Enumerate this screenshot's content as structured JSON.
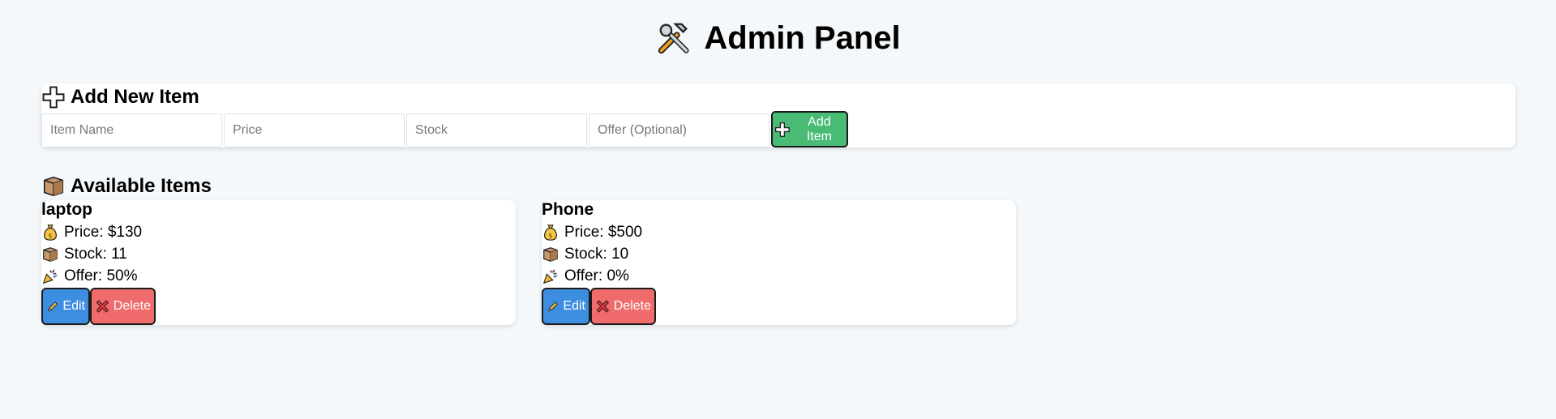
{
  "header": {
    "title": "Admin Panel",
    "icon": "hammer-wrench-icon"
  },
  "add_form": {
    "heading": "Add New Item",
    "heading_icon": "plus-icon",
    "fields": {
      "name_placeholder": "Item Name",
      "price_placeholder": "Price",
      "stock_placeholder": "Stock",
      "offer_placeholder": "Offer (Optional)"
    },
    "submit_label": "Add Item",
    "submit_color": "#49bb75"
  },
  "items_section": {
    "heading": "Available Items",
    "heading_icon": "package-icon",
    "items": [
      {
        "name": "laptop",
        "price": "Price: $130",
        "stock": "Stock: 11",
        "offer": "Offer: 50%",
        "edit_label": "Edit",
        "delete_label": "Delete"
      },
      {
        "name": "Phone",
        "price": "Price: $500",
        "stock": "Stock: 10",
        "offer": "Offer: 0%",
        "edit_label": "Edit",
        "delete_label": "Delete"
      }
    ]
  },
  "colors": {
    "edit": "#3d8de0",
    "delete": "#f06b6b",
    "background": "#f5f8fb"
  }
}
